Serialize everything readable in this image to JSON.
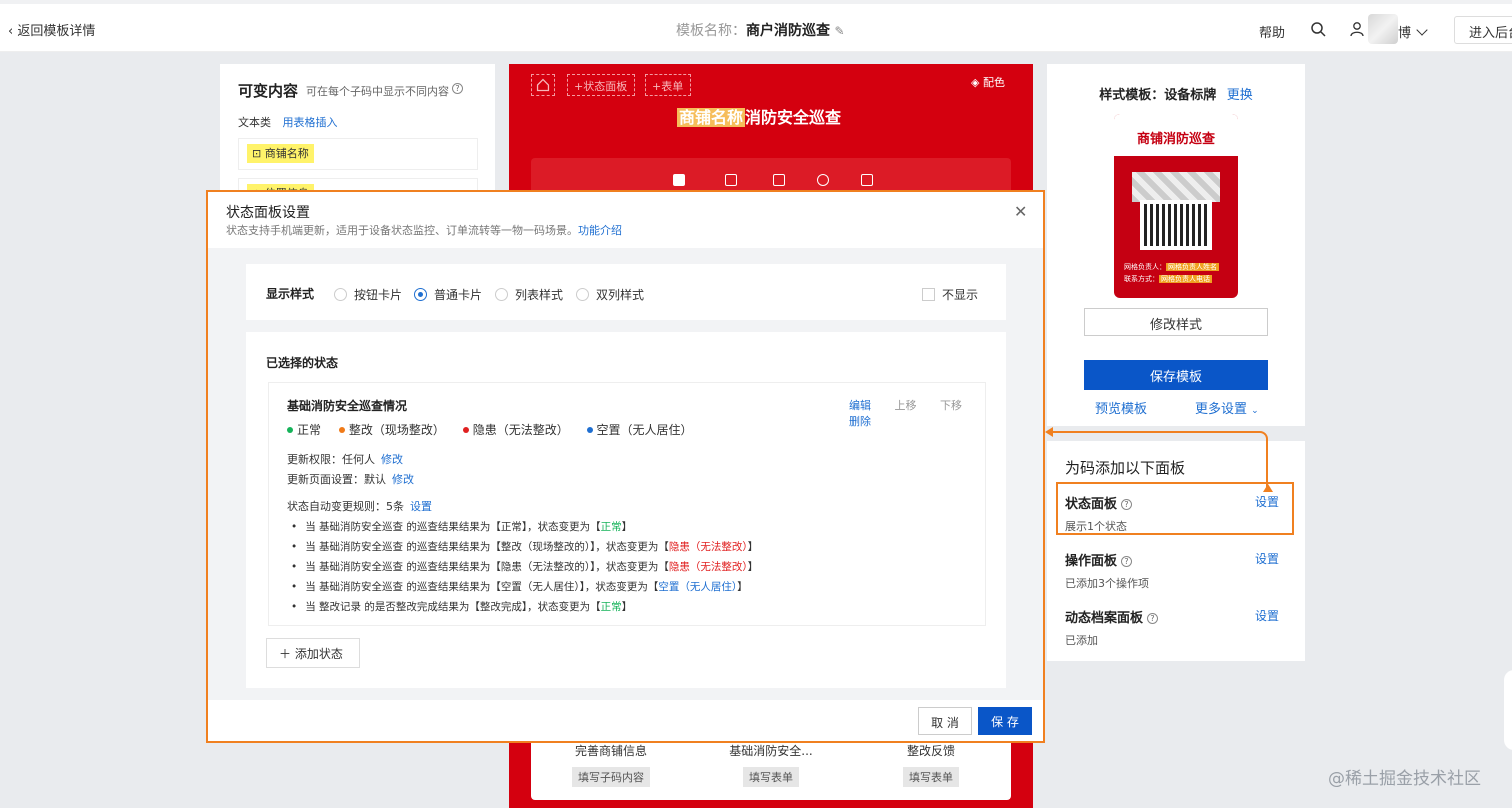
{
  "topbar": {
    "back_label": "返回模板详情",
    "template_key": "模板名称：",
    "template_name": "商户消防巡查",
    "help": "帮助",
    "user_name": "博",
    "enter_label": "进入后台"
  },
  "left_panel": {
    "title": "可变内容",
    "subtitle": "可在每个子码中显示不同内容",
    "category": "文本类",
    "insert_link": "用表格插入",
    "item1": "商铺名称",
    "item2": "位置信息"
  },
  "center": {
    "add_status": "+状态面板",
    "add_form": "+表单",
    "color_label": "配色",
    "title_hl": "商铺名称",
    "title_rest": "消防安全巡查",
    "bottom_cols": [
      {
        "name": "完善商铺信息",
        "chip": "填写子码内容"
      },
      {
        "name": "基础消防安全...",
        "chip": "填写表单"
      },
      {
        "name": "整改反馈",
        "chip": "填写表单"
      }
    ]
  },
  "right_top": {
    "style_label": "样式模板：设备标牌",
    "change_link": "更换",
    "card_title": "商铺消防巡查",
    "line1_key": "网格负责人：",
    "line1_val": "网格负责人姓名",
    "line2_key": "联系方式：",
    "line2_val": "网格负责人电话",
    "modify_style": "修改样式",
    "save_template": "保存模板",
    "preview_template": "预览模板",
    "more_settings": "更多设置"
  },
  "right_bottom": {
    "title": "为码添加以下面板",
    "items": [
      {
        "name": "状态面板",
        "desc": "展示1个状态",
        "set": "设置"
      },
      {
        "name": "操作面板",
        "desc": "已添加3个操作项",
        "set": "设置"
      },
      {
        "name": "动态档案面板",
        "desc": "已添加",
        "set": "设置"
      }
    ]
  },
  "modal": {
    "title": "状态面板设置",
    "subtitle": "状态支持手机端更新，适用于设备状态监控、订单流转等一物一码场景。",
    "intro_link": "功能介绍",
    "display_style_label": "显示样式",
    "styles": [
      "按钮卡片",
      "普通卡片",
      "列表样式",
      "双列样式"
    ],
    "selected_style": "普通卡片",
    "hide_label": "不显示",
    "selected_title": "已选择的状态",
    "card": {
      "name": "基础消防安全巡查情况",
      "actions": [
        "编辑",
        "上移",
        "下移",
        "删除"
      ],
      "statuses": [
        {
          "label": "正常",
          "color": "#16b35a"
        },
        {
          "label": "整改（现场整改）",
          "color": "#f07a18"
        },
        {
          "label": "隐患（无法整改）",
          "color": "#e02020"
        },
        {
          "label": "空置（无人居住）",
          "color": "#1f6fd1"
        }
      ],
      "perm_label": "更新权限：任何人",
      "perm_link": "修改",
      "page_label": "更新页面设置：默认",
      "page_link": "修改",
      "rules_label": "状态自动变更规则：5条",
      "rules_link": "设置",
      "rules": [
        {
          "pre": "当 基础消防安全巡查 的巡查结果结果为【正常】，状态变更为【",
          "val": "正常",
          "post": "】"
        },
        {
          "pre": "当 基础消防安全巡查 的巡查结果结果为【整改（现场整改的）】，状态变更为【",
          "val": "隐患（无法整改）",
          "post": "】"
        },
        {
          "pre": "当 基础消防安全巡查 的巡查结果结果为【隐患（无法整改的）】，状态变更为【",
          "val": "隐患（无法整改）",
          "post": "】"
        },
        {
          "pre": "当 基础消防安全巡查 的巡查结果结果为【空置（无人居住）】，状态变更为【",
          "val": "空置（无人居住）",
          "post": "】"
        },
        {
          "pre": "当 整改记录 的是否整改完成结果为【整改完成】，状态变更为【",
          "val": "正常",
          "post": "】"
        }
      ]
    },
    "add_status": "添加状态",
    "cancel": "取 消",
    "save": "保 存"
  },
  "watermark": "@稀土掘金技术社区"
}
